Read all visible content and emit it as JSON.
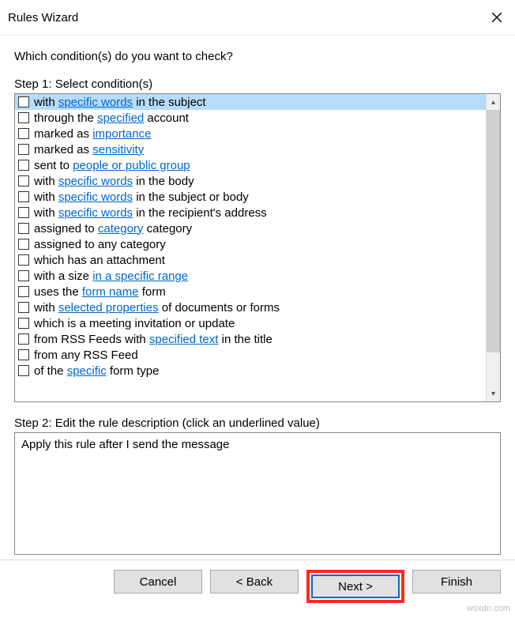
{
  "title": "Rules Wizard",
  "prompt": "Which condition(s) do you want to check?",
  "step1_label": "Step 1: Select condition(s)",
  "step2_label": "Step 2: Edit the rule description (click an underlined value)",
  "description_text": "Apply this rule after I send the message",
  "buttons": {
    "cancel": "Cancel",
    "back": "< Back",
    "next": "Next >",
    "finish": "Finish"
  },
  "watermark": "wsxdn.com",
  "conditions": [
    {
      "pre": "with ",
      "link": "specific words",
      "post": " in the subject",
      "selected": true
    },
    {
      "pre": "through the ",
      "link": "specified",
      "post": " account"
    },
    {
      "pre": "marked as ",
      "link": "importance",
      "post": ""
    },
    {
      "pre": "marked as ",
      "link": "sensitivity",
      "post": ""
    },
    {
      "pre": "sent to ",
      "link": "people or public group",
      "post": ""
    },
    {
      "pre": "with ",
      "link": "specific words",
      "post": " in the body"
    },
    {
      "pre": "with ",
      "link": "specific words",
      "post": " in the subject or body"
    },
    {
      "pre": "with ",
      "link": "specific words",
      "post": " in the recipient's address"
    },
    {
      "pre": "assigned to ",
      "link": "category",
      "post": " category"
    },
    {
      "pre": "assigned to any category",
      "link": "",
      "post": ""
    },
    {
      "pre": "which has an attachment",
      "link": "",
      "post": ""
    },
    {
      "pre": "with a size ",
      "link": "in a specific range",
      "post": ""
    },
    {
      "pre": "uses the ",
      "link": "form name",
      "post": " form"
    },
    {
      "pre": "with ",
      "link": "selected properties",
      "post": " of documents or forms"
    },
    {
      "pre": "which is a meeting invitation or update",
      "link": "",
      "post": ""
    },
    {
      "pre": "from RSS Feeds with ",
      "link": "specified text",
      "post": " in the title"
    },
    {
      "pre": "from any RSS Feed",
      "link": "",
      "post": ""
    },
    {
      "pre": "of the ",
      "link": "specific",
      "post": " form type"
    }
  ]
}
